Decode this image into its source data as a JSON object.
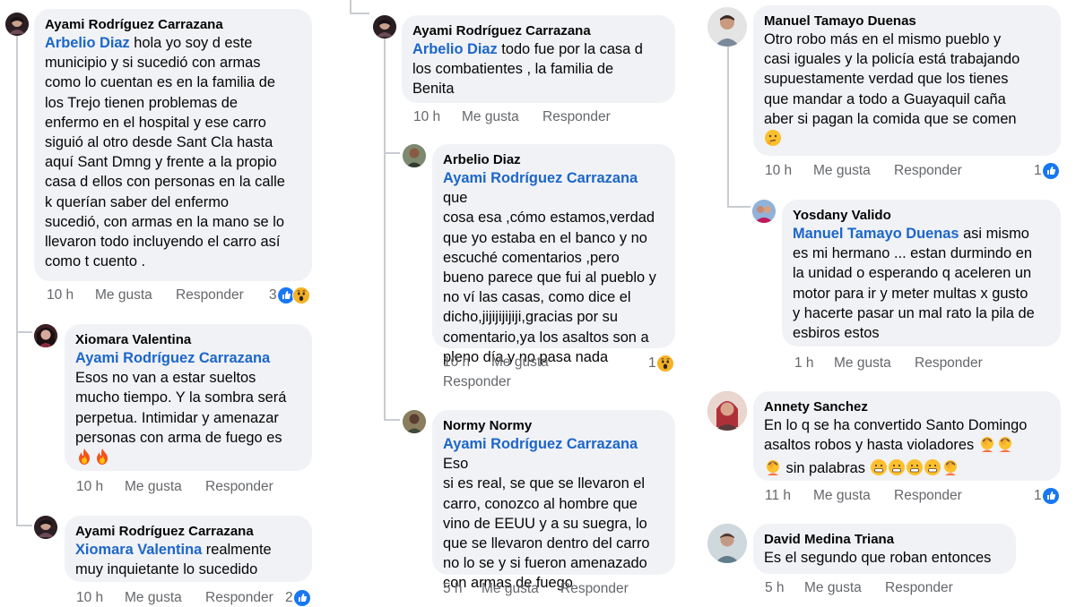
{
  "ui": {
    "like_label": "Me gusta",
    "reply_label": "Responder"
  },
  "colors": {
    "bubble": "#f0f2f5",
    "mention": "#1c66c9",
    "meta_text": "#65676b",
    "thread_line": "#c9ccd1"
  },
  "col1": {
    "c1": {
      "author": "Ayami Rodríguez Carrazana",
      "mention": "Arbelio Diaz",
      "text_l1": " hola yo soy d este",
      "lines": [
        "municipio y si sucedió con armas",
        "como lo cuentan es en la familia de",
        "los Trejo tienen problemas de",
        "enfermo en el hospital y ese carro",
        "siguió al otro desde Sant Cla hasta",
        "aquí Sant Dmng y frente a la propio",
        "casa d ellos con personas en la calle",
        "k querían saber del enfermo",
        "sucedió, con armas en la mano se lo",
        "llevaron todo incluyendo el carro así",
        "como t cuento ."
      ],
      "time": "10 h",
      "reaction_count": "3",
      "reaction_icons": [
        "like-icon",
        "wow-icon"
      ]
    },
    "c2": {
      "author": "Xiomara Valentina",
      "mention": "Ayami Rodríguez Carrazana",
      "lines": [
        "Esos no van a estar sueltos",
        "mucho tiempo. Y la sombra será",
        "perpetua. Intimidar y amenazar",
        "personas con arma de fuego es"
      ],
      "emoji_line": "fire-icon fire-icon",
      "time": "10 h"
    },
    "c3": {
      "author": "Ayami Rodríguez Carrazana",
      "mention": "Xiomara Valentina",
      "text_l1": " realmente",
      "lines": [
        "muy inquietante lo sucedido"
      ],
      "time": "10 h",
      "reaction_count": "2",
      "reaction_icons": [
        "like-icon"
      ]
    }
  },
  "col2": {
    "c1": {
      "author": "Ayami Rodríguez Carrazana",
      "mention": "Arbelio Diaz",
      "text_l1": " todo fue por la casa d",
      "lines": [
        "los combatientes , la familia de",
        "Benita"
      ],
      "time": "10 h"
    },
    "c2": {
      "author": "Arbelio Diaz",
      "mention": "Ayami Rodríguez Carrazana",
      "text_l1": " que",
      "lines": [
        "cosa esa ,cómo estamos,verdad",
        "que yo estaba en el banco y no",
        "escuché comentarios ,pero",
        "bueno parece que fui al pueblo y",
        "no ví las casas, como dice el",
        "dicho,jijijijijiji,gracias por su",
        "comentario,ya los asaltos son a",
        "pleno día y no pasa nada"
      ],
      "time": "10 h",
      "reaction_count": "1",
      "reaction_icons": [
        "wow-icon"
      ]
    },
    "c3": {
      "author": "Normy Normy",
      "mention": "Ayami Rodríguez Carrazana",
      "text_l1": " Eso",
      "lines": [
        "si es real, se que se llevaron el",
        "carro, conozco al hombre que",
        "vino de EEUU y a su suegra, lo",
        "que se llevaron dentro del carro",
        "no lo se y si fueron amenazado",
        "con armas de fuego"
      ],
      "time": "5 h"
    }
  },
  "col3": {
    "c1": {
      "author": "Manuel Tamayo Duenas",
      "lines": [
        "Otro  robo más en el mismo pueblo y",
        "casi iguales y la policía está trabajando",
        "supuestamente verdad que los tienes",
        "que mandar a todo a Guayaquil caña",
        "aber si pagan la comida que se comen"
      ],
      "emoji_line": "thinking-face-icon",
      "time": "10 h",
      "reaction_count": "1",
      "reaction_icons": [
        "like-icon"
      ]
    },
    "c2": {
      "author": "Yosdany Valido",
      "mention": "Manuel Tamayo Duenas",
      "text_l1": " asi mismo",
      "lines": [
        "es mi hermano ... estan durmindo en",
        "la unidad o esperando q aceleren un",
        "motor para ir y meter multas x gusto",
        "y hacerte pasar un mal rato la pila de",
        "esbiros estos"
      ],
      "time": "1 h"
    },
    "c3": {
      "author": "Annety Sanchez",
      "lines": [
        "En lo q se ha convertido Santo Domingo",
        "asaltos robos y hasta violadores"
      ],
      "line3_text": " sin palabras ",
      "time": "11 h",
      "reaction_count": "1",
      "reaction_icons": [
        "like-icon"
      ]
    },
    "c4": {
      "author": "David Medina Triana",
      "lines": [
        "Es el segundo que roban entonces"
      ],
      "time": "5 h"
    }
  }
}
